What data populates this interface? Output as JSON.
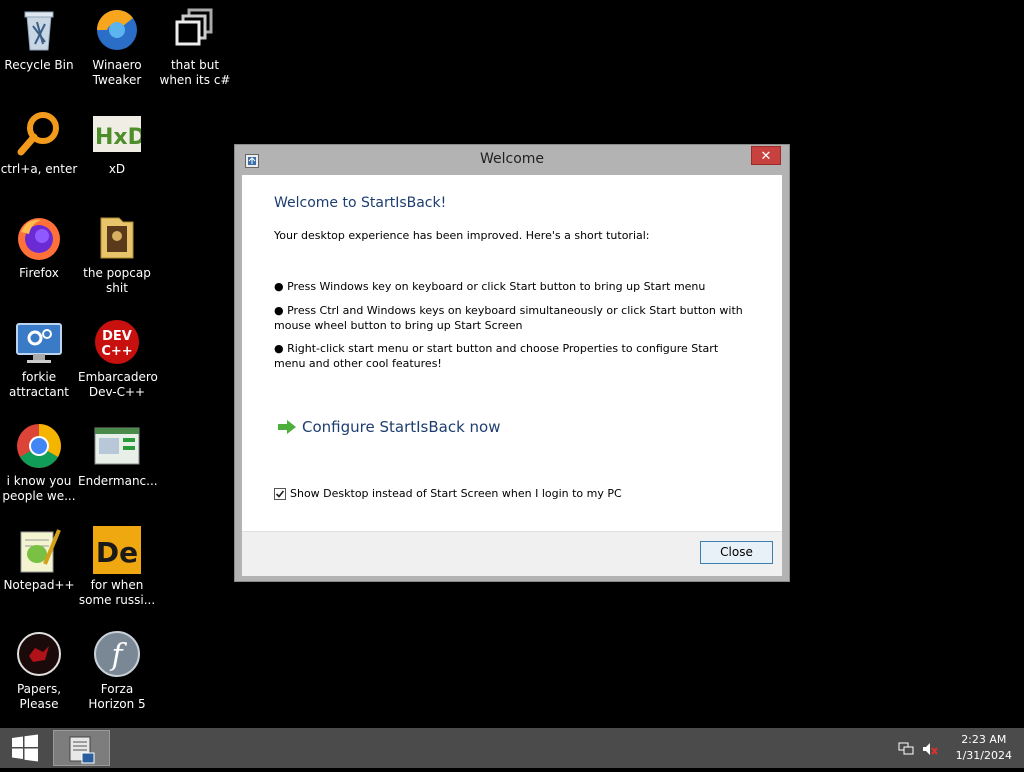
{
  "desktop": {
    "icons": [
      {
        "label": "Recycle Bin"
      },
      {
        "label": "Winaero Tweaker"
      },
      {
        "label": "that but when its c#"
      },
      {
        "label": "ctrl+a, enter"
      },
      {
        "label": "xD",
        "glyph": "HxD"
      },
      {
        "label": "Firefox"
      },
      {
        "label": "the popcap shit"
      },
      {
        "label": "forkie attractant"
      },
      {
        "label": "Embarcadero Dev-C++",
        "glyph_top": "DEV",
        "glyph_bottom": "C++"
      },
      {
        "label": "i know you people we..."
      },
      {
        "label": "Endermanc..."
      },
      {
        "label": "Notepad++"
      },
      {
        "label": "for when some russi...",
        "glyph": "De"
      },
      {
        "label": "Papers, Please"
      },
      {
        "label": "Forza Horizon 5",
        "glyph": "f"
      }
    ]
  },
  "dialog": {
    "title": "Welcome",
    "close_glyph": "✕",
    "headline": "Welcome to StartIsBack!",
    "intro": "Your desktop experience has been improved. Here's a short tutorial:",
    "bullets": [
      "● Press Windows key on keyboard or click Start button to bring up Start menu",
      "● Press Ctrl and Windows keys on keyboard simultaneously or click Start button with mouse wheel button to bring up Start Screen",
      "● Right-click start menu or start button and choose Properties to configure Start menu and other cool features!"
    ],
    "configure_link": "Configure StartIsBack now",
    "checkbox_label": "Show Desktop instead of Start Screen when I login to my PC",
    "checkbox_checked": true,
    "close_button": "Close"
  },
  "taskbar": {
    "time": "2:23 AM",
    "date": "1/31/2024"
  },
  "colors": {
    "headline": "#1e3d70",
    "close_red": "#c7413e",
    "taskbar": "#4b4b4b"
  }
}
